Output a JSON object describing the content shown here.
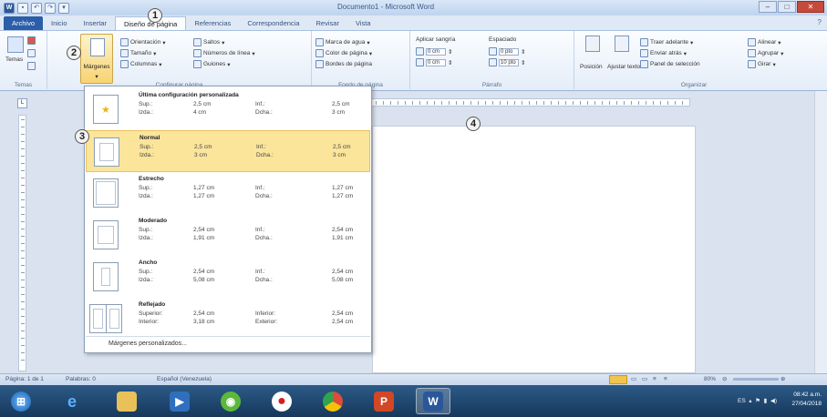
{
  "window": {
    "title": "Documento1 - Microsoft Word"
  },
  "tabs": [
    "Archivo",
    "Inicio",
    "Insertar",
    "Diseño de página",
    "Referencias",
    "Correspondencia",
    "Revisar",
    "Vista"
  ],
  "ribbon": {
    "temas": {
      "big_label": "Temas",
      "group_label": "Temas"
    },
    "configurar": {
      "margenes_label": "Márgenes",
      "orientacion": "Orientación",
      "tamano": "Tamaño",
      "columnas": "Columnas",
      "saltos": "Saltos",
      "numeros_linea": "Números de línea",
      "guiones": "Guiones",
      "group_label": "Configurar página"
    },
    "fondo": {
      "marca_agua": "Marca de agua",
      "color_pagina": "Color de página",
      "bordes_pagina": "Bordes de página",
      "group_label": "Fondo de página"
    },
    "parrafo": {
      "aplicar_sangria": "Aplicar sangría",
      "espaciado": "Espaciado",
      "izq_val": "0 cm",
      "der_val": "0 cm",
      "antes_val": "0 pto",
      "despues_val": "10 pto",
      "group_label": "Párrafo"
    },
    "organizar": {
      "posicion": "Posición",
      "ajustar_texto": "Ajustar texto",
      "traer_adelante": "Traer adelante",
      "enviar_atras": "Enviar atrás",
      "panel_seleccion": "Panel de selección",
      "alinear": "Alinear",
      "agrupar": "Agrupar",
      "girar": "Girar",
      "group_label": "Organizar"
    }
  },
  "margins_menu": {
    "items": [
      {
        "name": "Última configuración personalizada",
        "l1": "Sup.:",
        "v1": "2,5 cm",
        "l2": "Inf.:",
        "v2": "2,5 cm",
        "l3": "Izda.:",
        "v3": "4 cm",
        "l4": "Dcha.:",
        "v4": "3 cm"
      },
      {
        "name": "Normal",
        "l1": "Sup.:",
        "v1": "2,5 cm",
        "l2": "Inf.:",
        "v2": "2,5 cm",
        "l3": "Izda.:",
        "v3": "3 cm",
        "l4": "Dcha.:",
        "v4": "3 cm"
      },
      {
        "name": "Estrecho",
        "l1": "Sup.:",
        "v1": "1,27 cm",
        "l2": "Inf.:",
        "v2": "1,27 cm",
        "l3": "Izda.:",
        "v3": "1,27 cm",
        "l4": "Dcha.:",
        "v4": "1,27 cm"
      },
      {
        "name": "Moderado",
        "l1": "Sup.:",
        "v1": "2,54 cm",
        "l2": "Inf.:",
        "v2": "2,54 cm",
        "l3": "Izda.:",
        "v3": "1,91 cm",
        "l4": "Dcha.:",
        "v4": "1,91 cm"
      },
      {
        "name": "Ancho",
        "l1": "Sup.:",
        "v1": "2,54 cm",
        "l2": "Inf.:",
        "v2": "2,54 cm",
        "l3": "Izda.:",
        "v3": "5,08 cm",
        "l4": "Dcha.:",
        "v4": "5,08 cm"
      },
      {
        "name": "Reflejado",
        "l1": "Superior:",
        "v1": "2,54 cm",
        "l2": "Inferior:",
        "v2": "2,54 cm",
        "l3": "Interior:",
        "v3": "3,18 cm",
        "l4": "Exterior:",
        "v4": "2,54 cm"
      }
    ],
    "custom": "Márgenes personalizados..."
  },
  "callouts": [
    "1",
    "2",
    "3",
    "4"
  ],
  "status": {
    "page": "Página: 1 de 1",
    "words": "Palabras: 0",
    "language": "Español (Venezuela)",
    "zoom": "80%"
  },
  "taskbar": {
    "tray_lang": "ES",
    "time": "08:42 a.m.",
    "date": "27/04/2018"
  }
}
